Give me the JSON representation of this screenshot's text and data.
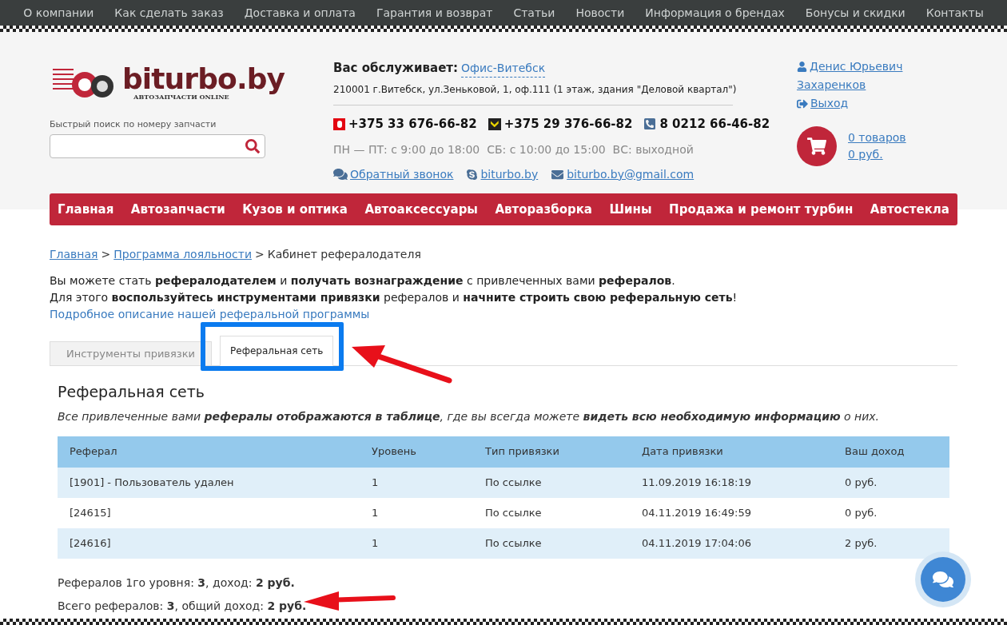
{
  "top_menu": [
    "О компании",
    "Как сделать заказ",
    "Доставка и оплата",
    "Гарантия и возврат",
    "Статьи",
    "Новости",
    "Информация о брендах",
    "Бонусы и скидки",
    "Контакты"
  ],
  "logo": {
    "name": "biturbo.by",
    "tagline": "АВТОЗАПЧАСТИ ONLINE"
  },
  "search": {
    "label": "Быстрый поиск по номеру запчасти"
  },
  "office": {
    "label": "Вас обслуживает:",
    "name": "Офис-Витебск",
    "address": "210001 г.Витебск, ул.Зеньковой, 1, оф.111 (1 этаж, здания \"Деловой квартал\")"
  },
  "phones": [
    {
      "kind": "mts",
      "number": "+375 33 676-66-82"
    },
    {
      "kind": "velcom",
      "number": "+375 29 376-66-82"
    },
    {
      "kind": "landline",
      "number": "8 0212 66-46-82"
    }
  ],
  "hours": "ПН — ПТ: с 9:00 до 18:00  СБ: с 10:00 до 15:00  ВС: выходной",
  "contacts": [
    {
      "kind": "callback",
      "label": "Обратный звонок"
    },
    {
      "kind": "skype",
      "label": "biturbo.by"
    },
    {
      "kind": "email",
      "label": "biturbo.by@gmail.com"
    }
  ],
  "user": {
    "name_line1": "Денис Юрьевич",
    "name_line2": "Захаренков",
    "logout": "Выход"
  },
  "cart": {
    "items": "0 товаров",
    "total": "0 руб."
  },
  "main_menu": [
    "Главная",
    "Автозапчасти",
    "Кузов и оптика",
    "Автоаксессуары",
    "Авторазборка",
    "Шины",
    "Продажа и ремонт турбин",
    "Автостекла"
  ],
  "breadcrumbs": {
    "links": [
      "Главная",
      "Программа лояльности"
    ],
    "separator": ">",
    "current": "Кабинет рефералодателя"
  },
  "intro": [
    "Вы можете стать **рефералодателем** и **получать вознаграждение** с привлеченных вами **рефералов**.",
    "Для этого **воспользуйтесь инструментами привязки** рефералов и **начните строить свою реферальную сеть**!"
  ],
  "program_link": "Подробное описание нашей реферальной программы",
  "tabs": [
    {
      "label": "Инструменты привязки",
      "selected": false
    },
    {
      "label": "Реферальная сеть",
      "selected": true
    }
  ],
  "section": {
    "title": "Реферальная сеть",
    "description": "Все привлеченные вами **рефералы отображаются в таблице**, где вы всегда можете **видеть всю необходимую информацию** о них."
  },
  "table": {
    "columns": [
      "Реферал",
      "Уровень",
      "Тип привязки",
      "Дата привязки",
      "Ваш доход"
    ],
    "rows": [
      [
        "[1901] - Пользователь удален",
        "1",
        "По ссылке",
        "11.09.2019 16:18:19",
        "0 руб."
      ],
      [
        "[24615]",
        "1",
        "По ссылке",
        "04.11.2019 16:49:59",
        "0 руб."
      ],
      [
        "[24616]",
        "1",
        "По ссылке",
        "04.11.2019 17:04:06",
        "2 руб."
      ]
    ]
  },
  "summary": [
    "Рефералов 1го уровня: **3**, доход: **2 руб.**",
    "Всего рефералов: **3**, общий доход: **2 руб.**"
  ]
}
